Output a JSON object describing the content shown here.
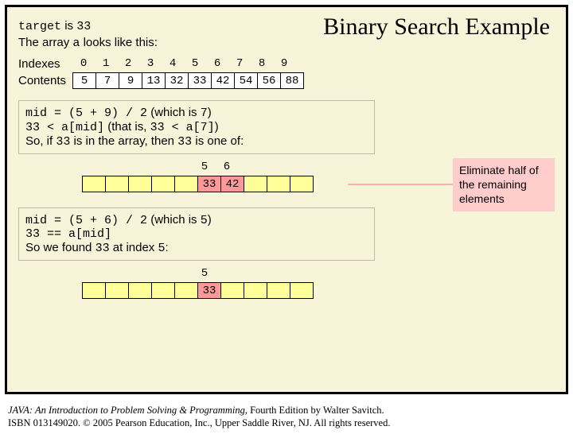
{
  "title": "Binary Search Example",
  "intro": {
    "target_label": "target",
    "target_is": "is",
    "target_value": "33",
    "array_sentence_prefix": "The array",
    "array_name": "a",
    "array_sentence_suffix": "looks like this:"
  },
  "labels": {
    "indexes": "Indexes",
    "contents": "Contents"
  },
  "array": {
    "indexes": [
      "0",
      "1",
      "2",
      "3",
      "4",
      "5",
      "6",
      "7",
      "8",
      "9"
    ],
    "contents": [
      "5",
      "7",
      "9",
      "13",
      "32",
      "33",
      "42",
      "54",
      "56",
      "88"
    ]
  },
  "step1": {
    "line1a": "mid = (5 + 9) / 2",
    "line1b": "(which is",
    "line1c": "7",
    "line1d": ")",
    "line2a": "33 < a[mid]",
    "line2b": "(that is,",
    "line2c": "33 < a[7]",
    "line2d": ")",
    "line3a": "So, if",
    "line3b": "33",
    "line3c": "is in the array, then",
    "line3d": "33",
    "line3e": "is one of:",
    "sub_indexes": [
      "",
      "",
      "",
      "",
      "",
      "5",
      "6",
      "",
      "",
      ""
    ],
    "sub_contents": [
      "",
      "",
      "",
      "",
      "",
      "33",
      "42",
      "",
      "",
      ""
    ]
  },
  "note": {
    "text": "Eliminate half of the remaining elements"
  },
  "step2": {
    "line1a": "mid = (5 + 6) / 2",
    "line1b": "(which is",
    "line1c": "5",
    "line1d": ")",
    "line2": "33 == a[mid]",
    "line3a": "So we found",
    "line3b": "33",
    "line3c": "at index",
    "line3d": "5",
    "line3e": ":",
    "sub_indexes": [
      "",
      "",
      "",
      "",
      "",
      "5",
      "",
      "",
      "",
      ""
    ],
    "sub_contents": [
      "",
      "",
      "",
      "",
      "",
      "33",
      "",
      "",
      "",
      ""
    ]
  },
  "footer": {
    "line1_a": "JAVA: An Introduction to Problem Solving & Programming, ",
    "line1_b": "Fourth Edition by Walter Savitch.",
    "line2": "ISBN 013149020. © 2005 Pearson Education, Inc., Upper Saddle River, NJ. All rights reserved."
  }
}
